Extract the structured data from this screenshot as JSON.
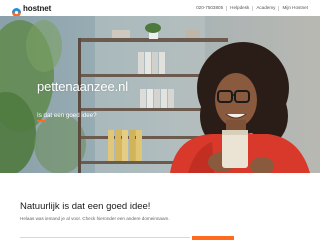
{
  "header": {
    "logo_text": "hostnet",
    "phone": "020-7503805",
    "nav": [
      "Helpdesk",
      "Academy",
      "Mijn Hostnet"
    ]
  },
  "hero": {
    "domain": "pettenaanzee.nl",
    "subtitle": "Is dat een goed idee?"
  },
  "content": {
    "heading": "Natuurlijk is dat een goed idee!",
    "text": "Helaas was iemand je al voor. Check hieronder een andere domeinnaam."
  },
  "colors": {
    "accent": "#ff6a1e",
    "logo_blue": "#1d8fe0",
    "logo_orange": "#ff6a1e"
  }
}
